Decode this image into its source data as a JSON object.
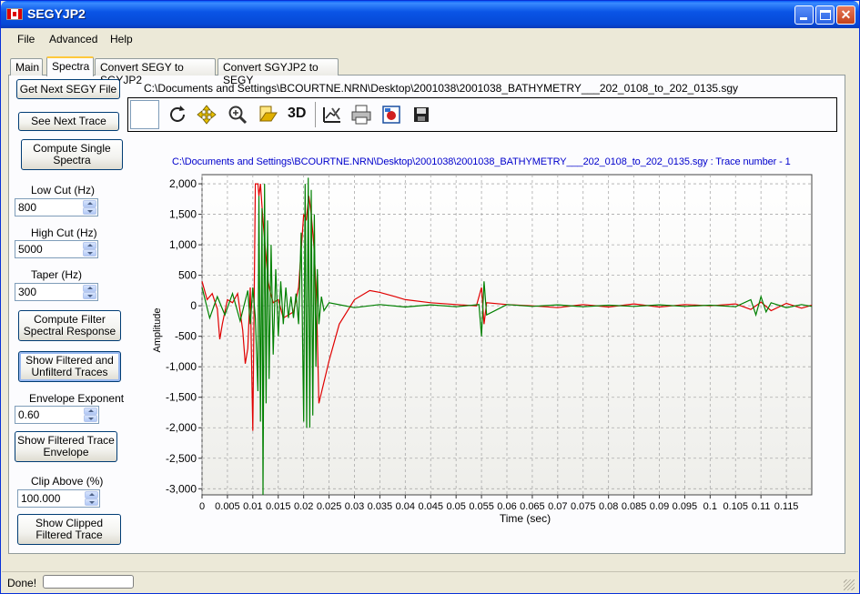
{
  "window": {
    "title": "SEGYJP2"
  },
  "menu": [
    "File",
    "Advanced",
    "Help"
  ],
  "tabs": [
    "Main",
    "Spectra",
    "Convert SEGY to SGYJP2",
    "Convert SGYJP2 to SEGY"
  ],
  "active_tab": "Spectra",
  "left_panel": {
    "get_next_segy": "Get Next SEGY File",
    "see_next_trace": "See Next Trace",
    "compute_single_1": "Compute Single",
    "compute_single_2": "Spectra",
    "low_cut_label": "Low Cut (Hz)",
    "low_cut_value": "800",
    "high_cut_label": "High Cut (Hz)",
    "high_cut_value": "5000",
    "taper_label": "Taper (Hz)",
    "taper_value": "300",
    "compute_filter_1": "Compute Filter",
    "compute_filter_2": "Spectral Response",
    "show_filtered_1": "Show Filtered and",
    "show_filtered_2": "Unfilterd Traces",
    "envelope_exp_label": "Envelope Exponent",
    "envelope_exp_value": "0.60",
    "show_envelope_1": "Show Filtered Trace",
    "show_envelope_2": "Envelope",
    "clip_label": "Clip Above (%)",
    "clip_value": "100.000",
    "show_clipped_1": "Show Clipped",
    "show_clipped_2": "Filtered Trace"
  },
  "file_path": "C:\\Documents and Settings\\BCOURTNE.NRN\\Desktop\\2001038\\2001038_BATHYMETRY___202_0108_to_202_0135.sgy",
  "toolbar": {
    "icons": [
      "refresh-icon",
      "pan-icon",
      "zoom-icon",
      "open-icon",
      "3d-icon",
      "edit-chart-icon",
      "print-icon",
      "export-icon",
      "save-icon"
    ],
    "label_3d": "3D"
  },
  "status": {
    "text": "Done!"
  },
  "chart_data": {
    "type": "line",
    "title": "C:\\Documents and Settings\\BCOURTNE.NRN\\Desktop\\2001038\\2001038_BATHYMETRY___202_0108_to_202_0135.sgy : Trace number - 1",
    "xlabel": "Time (sec)",
    "ylabel": "Amplitude",
    "xlim": [
      0,
      0.12
    ],
    "ylim": [
      -3100,
      2150
    ],
    "x_ticks": [
      "0",
      "0.005",
      "0.01",
      "0.015",
      "0.02",
      "0.025",
      "0.03",
      "0.035",
      "0.04",
      "0.045",
      "0.05",
      "0.055",
      "0.06",
      "0.065",
      "0.07",
      "0.075",
      "0.08",
      "0.085",
      "0.09",
      "0.095",
      "0.1",
      "0.105",
      "0.11",
      "0.115"
    ],
    "y_ticks": [
      "2,000",
      "1,500",
      "1,000",
      "500",
      "0",
      "-500",
      "-1,000",
      "-1,500",
      "-2,000",
      "-2,500",
      "-3,000"
    ],
    "y_tick_values": [
      2000,
      1500,
      1000,
      500,
      0,
      -500,
      -1000,
      -1500,
      -2000,
      -2500,
      -3000
    ],
    "grid": true,
    "series": [
      {
        "color": "#e00000",
        "x": [
          0,
          0.001,
          0.002,
          0.003,
          0.0035,
          0.004,
          0.005,
          0.006,
          0.007,
          0.008,
          0.0085,
          0.009,
          0.0095,
          0.01,
          0.0105,
          0.011,
          0.0112,
          0.0115,
          0.012,
          0.0125,
          0.013,
          0.0135,
          0.014,
          0.015,
          0.016,
          0.018,
          0.019,
          0.02,
          0.0205,
          0.021,
          0.0215,
          0.022,
          0.0225,
          0.023,
          0.025,
          0.027,
          0.03,
          0.033,
          0.035,
          0.038,
          0.04,
          0.045,
          0.05,
          0.054,
          0.055,
          0.0555,
          0.056,
          0.06,
          0.065,
          0.07,
          0.075,
          0.08,
          0.085,
          0.09,
          0.095,
          0.1,
          0.105,
          0.108,
          0.11,
          0.112,
          0.115,
          0.118,
          0.12
        ],
        "y": [
          400,
          100,
          200,
          -50,
          -550,
          -300,
          100,
          50,
          200,
          -400,
          -950,
          -700,
          300,
          -2050,
          2000,
          2000,
          1800,
          2000,
          1400,
          900,
          400,
          200,
          50,
          100,
          -200,
          -100,
          300,
          1500,
          1400,
          1800,
          1500,
          1000,
          200,
          -1600,
          -900,
          -300,
          100,
          250,
          220,
          150,
          100,
          50,
          20,
          0,
          300,
          -300,
          50,
          20,
          0,
          -30,
          20,
          -20,
          30,
          -20,
          20,
          0,
          30,
          -60,
          60,
          -80,
          40,
          -40,
          10
        ]
      },
      {
        "color": "#008000",
        "x": [
          0,
          0.0015,
          0.003,
          0.0045,
          0.006,
          0.0075,
          0.009,
          0.0095,
          0.01,
          0.0105,
          0.011,
          0.0112,
          0.0115,
          0.0118,
          0.012,
          0.0123,
          0.0126,
          0.0129,
          0.0132,
          0.0136,
          0.014,
          0.0145,
          0.015,
          0.0155,
          0.016,
          0.0165,
          0.017,
          0.0175,
          0.018,
          0.0185,
          0.019,
          0.0195,
          0.02,
          0.0203,
          0.0206,
          0.0209,
          0.0212,
          0.0215,
          0.0218,
          0.0221,
          0.0224,
          0.0227,
          0.023,
          0.0235,
          0.024,
          0.025,
          0.03,
          0.035,
          0.04,
          0.045,
          0.05,
          0.0545,
          0.055,
          0.0555,
          0.056,
          0.06,
          0.065,
          0.07,
          0.075,
          0.08,
          0.085,
          0.09,
          0.095,
          0.1,
          0.105,
          0.108,
          0.109,
          0.11,
          0.111,
          0.112,
          0.115,
          0.118,
          0.12
        ],
        "y": [
          300,
          -200,
          150,
          -150,
          200,
          -250,
          250,
          -300,
          300,
          -200,
          -1400,
          1800,
          -1900,
          1600,
          -3100,
          2000,
          -1600,
          1400,
          -1200,
          1000,
          -800,
          600,
          -500,
          400,
          -300,
          300,
          -200,
          150,
          -200,
          200,
          -300,
          1200,
          -1900,
          2000,
          -2000,
          2100,
          -2000,
          1900,
          -1800,
          1500,
          -1000,
          600,
          -300,
          150,
          -80,
          50,
          -30,
          20,
          -20,
          15,
          -15,
          20,
          -500,
          400,
          -150,
          20,
          -10,
          15,
          -15,
          10,
          -10,
          15,
          -10,
          10,
          -15,
          100,
          -150,
          150,
          -100,
          50,
          -30,
          20,
          -10
        ]
      }
    ]
  }
}
